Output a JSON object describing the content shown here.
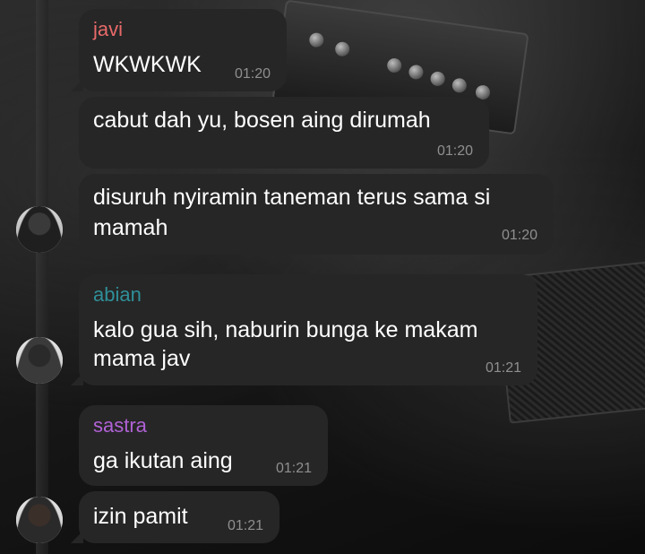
{
  "messages": [
    {
      "sender": "javi",
      "sender_color": "#e86a6a",
      "lines": [
        "WKWKWK"
      ],
      "time": "01:20"
    },
    {
      "lines": [
        "cabut dah yu, bosen aing dirumah"
      ],
      "time": "01:20"
    },
    {
      "lines": [
        "disuruh nyiramin taneman terus sama si",
        "mamah"
      ],
      "time": "01:20"
    },
    {
      "sender": "abian",
      "sender_color": "#2f8f99",
      "lines": [
        "kalo gua sih, naburin bunga ke makam",
        "mama jav"
      ],
      "time": "01:21"
    },
    {
      "sender": "sastra",
      "sender_color": "#b062d6",
      "lines": [
        "ga ikutan aing"
      ],
      "time": "01:21"
    },
    {
      "lines": [
        "izin pamit"
      ],
      "time": "01:21"
    }
  ]
}
